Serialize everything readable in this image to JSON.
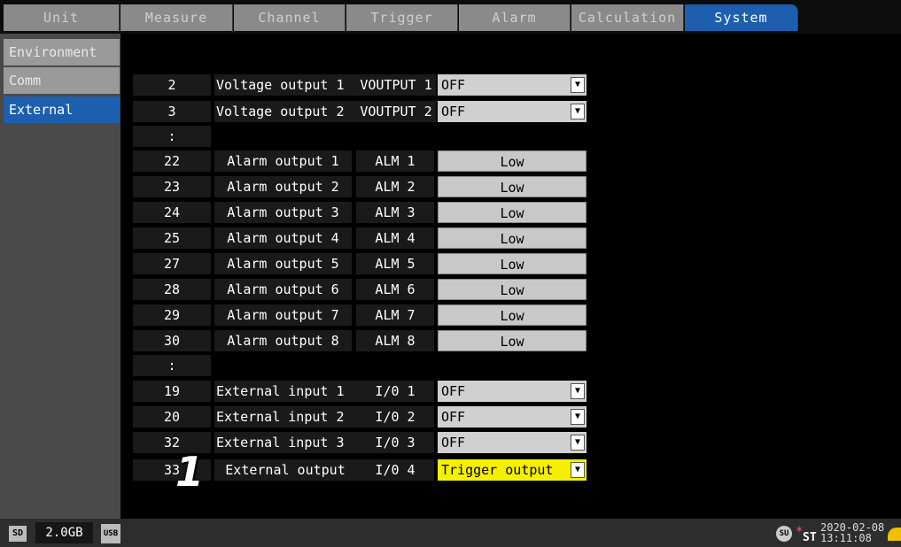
{
  "tabs": [
    {
      "label": "Unit",
      "active": false
    },
    {
      "label": "Measure",
      "active": false
    },
    {
      "label": "Channel",
      "active": false
    },
    {
      "label": "Trigger",
      "active": false
    },
    {
      "label": "Alarm",
      "active": false
    },
    {
      "label": "Calculation",
      "active": false
    },
    {
      "label": "System",
      "active": true
    }
  ],
  "sidebar": {
    "items": [
      {
        "label": "Environment",
        "active": false
      },
      {
        "label": "Comm",
        "active": false
      },
      {
        "label": "External",
        "active": true
      }
    ]
  },
  "rows": [
    {
      "num": "2",
      "name": "Voltage output 1",
      "code": "VOUTPUT 1",
      "value": "OFF",
      "kind": "dropdown"
    },
    {
      "num": "3",
      "name": "Voltage output 2",
      "code": "VOUTPUT 2",
      "value": "OFF",
      "kind": "dropdown"
    },
    {
      "num": ":",
      "kind": "separator"
    },
    {
      "num": "22",
      "name": "Alarm output 1",
      "code": "ALM 1",
      "value": "Low",
      "kind": "level"
    },
    {
      "num": "23",
      "name": "Alarm output 2",
      "code": "ALM 2",
      "value": "Low",
      "kind": "level"
    },
    {
      "num": "24",
      "name": "Alarm output 3",
      "code": "ALM 3",
      "value": "Low",
      "kind": "level"
    },
    {
      "num": "25",
      "name": "Alarm output 4",
      "code": "ALM 4",
      "value": "Low",
      "kind": "level"
    },
    {
      "num": "27",
      "name": "Alarm output 5",
      "code": "ALM 5",
      "value": "Low",
      "kind": "level"
    },
    {
      "num": "28",
      "name": "Alarm output 6",
      "code": "ALM 6",
      "value": "Low",
      "kind": "level"
    },
    {
      "num": "29",
      "name": "Alarm output 7",
      "code": "ALM 7",
      "value": "Low",
      "kind": "level"
    },
    {
      "num": "30",
      "name": "Alarm output 8",
      "code": "ALM 8",
      "value": "Low",
      "kind": "level"
    },
    {
      "num": ":",
      "kind": "separator"
    },
    {
      "num": "19",
      "name": "External input 1",
      "code": "I/0 1",
      "value": "OFF",
      "kind": "dropdown"
    },
    {
      "num": "20",
      "name": "External input 2",
      "code": "I/0 2",
      "value": "OFF",
      "kind": "dropdown"
    },
    {
      "num": "32",
      "name": "External input 3",
      "code": "I/0 3",
      "value": "OFF",
      "kind": "dropdown"
    },
    {
      "num": "33",
      "name": "External output",
      "code": "I/0 4",
      "value": "Trigger output",
      "kind": "dropdown",
      "highlight": true
    }
  ],
  "callout": "1",
  "status": {
    "sd_label": "SD",
    "storage": "2.0GB",
    "usb_label": "USB",
    "su_label": "SU",
    "st_label": "ST",
    "date": "2020-02-08",
    "time": "13:11:08"
  },
  "icons": {
    "dropdown": "chevron-down-icon",
    "sd": "sd-card-icon",
    "usb": "usb-icon",
    "sync": "sync-icon"
  },
  "colors": {
    "active_tab": "#1d5fae",
    "highlight": "#f5f000",
    "dropdown_bg": "#d0d0d0"
  }
}
